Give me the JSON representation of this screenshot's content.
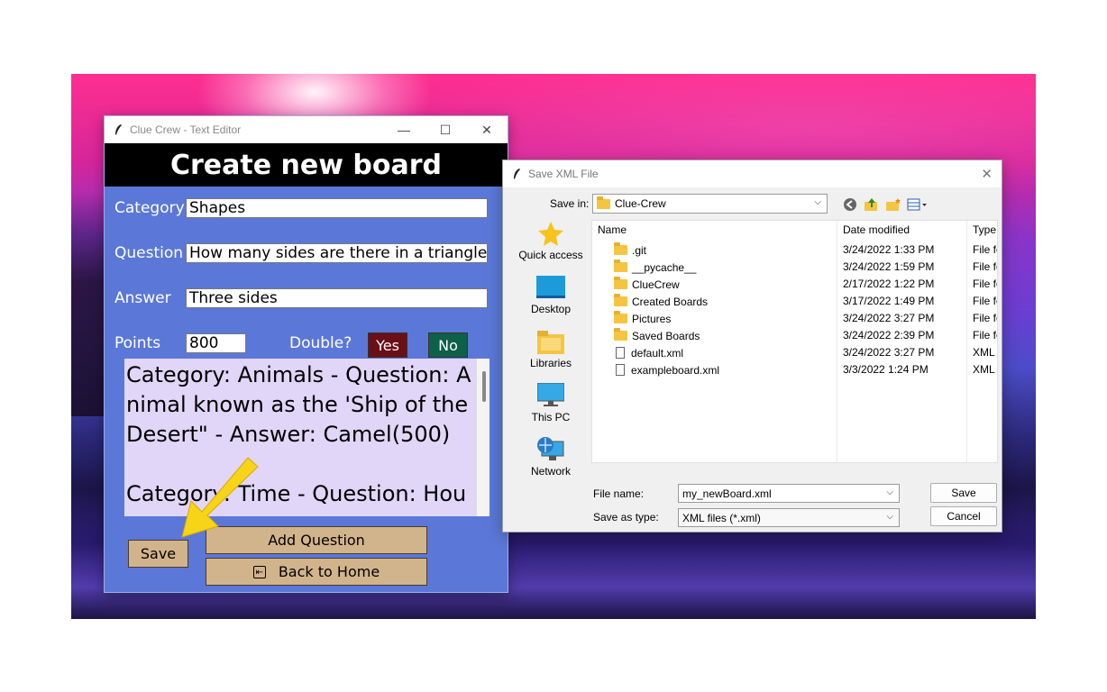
{
  "editor": {
    "title": "Clue Crew - Text Editor",
    "header": "Create new board",
    "labels": {
      "category": "Category",
      "question": "Question",
      "answer": "Answer",
      "points": "Points",
      "double": "Double?"
    },
    "values": {
      "category": "Shapes",
      "question": "How many sides are there in a triangle?",
      "answer": "Three sides",
      "points": "800"
    },
    "buttons": {
      "yes": "Yes",
      "no": "No",
      "save": "Save",
      "add_question": "Add Question",
      "back_home": "Back to Home"
    },
    "preview_text": "Category: Animals - Question: Animal known as the 'Ship of the Desert\" - Answer: Camel(500)\n\nCategory: Time - Question: Hou"
  },
  "dialog": {
    "title": "Save XML File",
    "save_in_label": "Save in:",
    "save_in_value": "Clue-Crew",
    "places": [
      {
        "label": "Quick access",
        "icon": "star-icon"
      },
      {
        "label": "Desktop",
        "icon": "desktop-icon"
      },
      {
        "label": "Libraries",
        "icon": "libraries-icon"
      },
      {
        "label": "This PC",
        "icon": "pc-icon"
      },
      {
        "label": "Network",
        "icon": "network-icon"
      }
    ],
    "columns": {
      "name": "Name",
      "date": "Date modified",
      "type": "Type"
    },
    "files": [
      {
        "name": ".git",
        "date": "3/24/2022 1:33 PM",
        "type": "File fo",
        "kind": "folder"
      },
      {
        "name": "__pycache__",
        "date": "3/24/2022 1:59 PM",
        "type": "File fo",
        "kind": "folder"
      },
      {
        "name": "ClueCrew",
        "date": "2/17/2022 1:22 PM",
        "type": "File fo",
        "kind": "folder"
      },
      {
        "name": "Created Boards",
        "date": "3/17/2022 1:49 PM",
        "type": "File fo",
        "kind": "folder"
      },
      {
        "name": "Pictures",
        "date": "3/24/2022 3:27 PM",
        "type": "File fo",
        "kind": "folder"
      },
      {
        "name": "Saved Boards",
        "date": "3/24/2022 2:39 PM",
        "type": "File fo",
        "kind": "folder"
      },
      {
        "name": "default.xml",
        "date": "3/24/2022 3:27 PM",
        "type": "XML",
        "kind": "file"
      },
      {
        "name": "exampleboard.xml",
        "date": "3/3/2022 1:24 PM",
        "type": "XML",
        "kind": "file"
      }
    ],
    "file_name_label": "File name:",
    "file_name_value": "my_newBoard.xml",
    "save_as_type_label": "Save as type:",
    "save_as_type_value": "XML files (*.xml)",
    "save_button": "Save",
    "cancel_button": "Cancel"
  },
  "colors": {
    "editor_bg": "#5b78d8",
    "yes_button": "#6b0f17",
    "no_button": "#0e6048",
    "tan_button": "#d2b48c",
    "preview_bg": "#e1d6f7",
    "arrow": "#f7d417"
  }
}
